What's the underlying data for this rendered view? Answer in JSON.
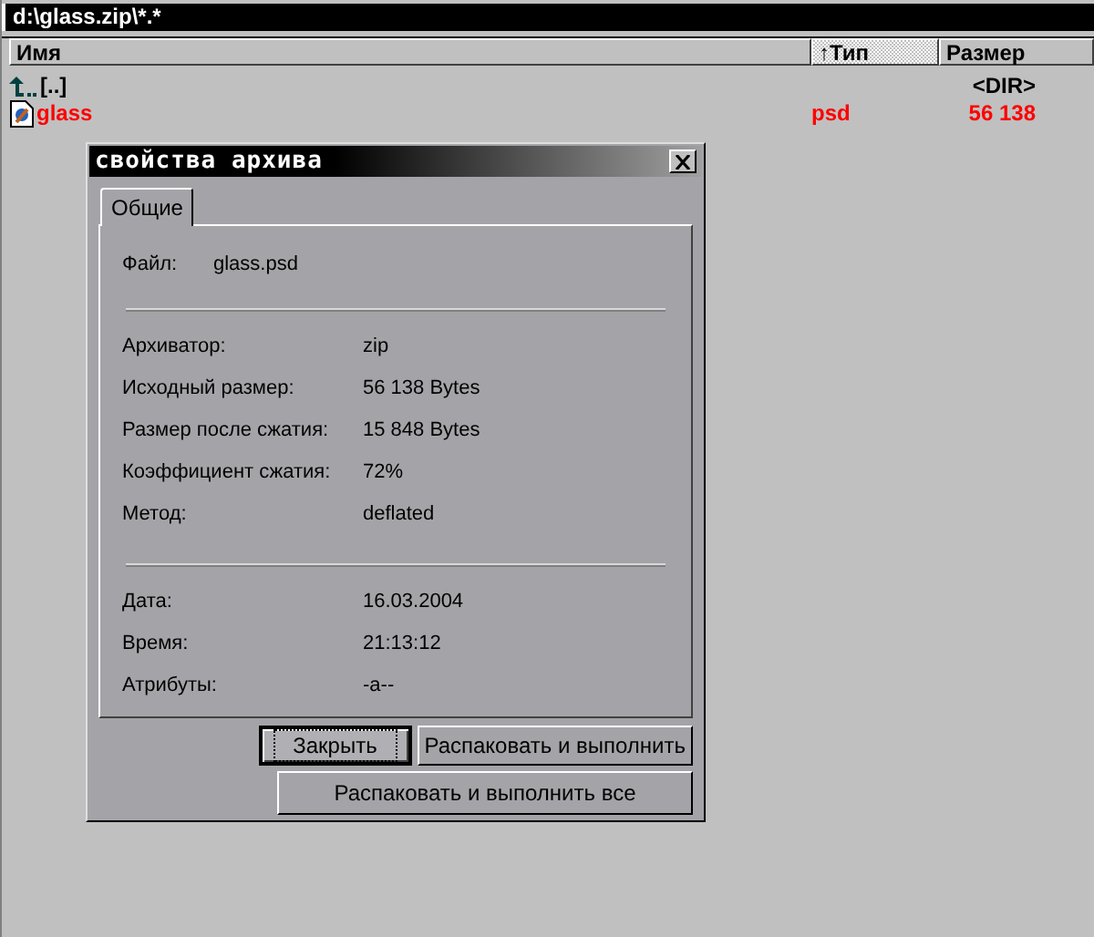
{
  "path_bar": {
    "text": "d:\\glass.zip\\*.*"
  },
  "columns": [
    {
      "label": "Имя",
      "sorted": false
    },
    {
      "label": "↑Тип",
      "sorted": true
    },
    {
      "label": "Размер",
      "sorted": false
    }
  ],
  "rows": [
    {
      "kind": "parent",
      "name": "[..]",
      "type": "",
      "size": "<DIR>",
      "color": "#000000"
    },
    {
      "kind": "file",
      "name": "glass",
      "type": "psd",
      "size": "56 138",
      "color": "#ff0000"
    }
  ],
  "dialog": {
    "title": "свойства архива",
    "tabs": [
      {
        "label": "Общие",
        "selected": true
      }
    ],
    "groups": [
      [
        {
          "label": "Файл:",
          "value": "glass.psd"
        }
      ],
      [
        {
          "label": "Архиватор:",
          "value": "zip"
        },
        {
          "label": "Исходный размер:",
          "value": "56 138 Bytes"
        },
        {
          "label": "Размер после сжатия:",
          "value": "15 848 Bytes"
        },
        {
          "label": "Коэффициент сжатия:",
          "value": "72%"
        },
        {
          "label": "Метод:",
          "value": "deflated"
        }
      ],
      [
        {
          "label": "Дата:",
          "value": "16.03.2004"
        },
        {
          "label": "Время:",
          "value": "21:13:12"
        },
        {
          "label": "Атрибуты:",
          "value": "-a--"
        }
      ]
    ],
    "buttons": [
      {
        "label": "Закрыть",
        "focused": true
      },
      {
        "label": "Распаковать и выполнить",
        "focused": false
      },
      {
        "label": "Распаковать и выполнить все",
        "focused": false
      }
    ]
  }
}
